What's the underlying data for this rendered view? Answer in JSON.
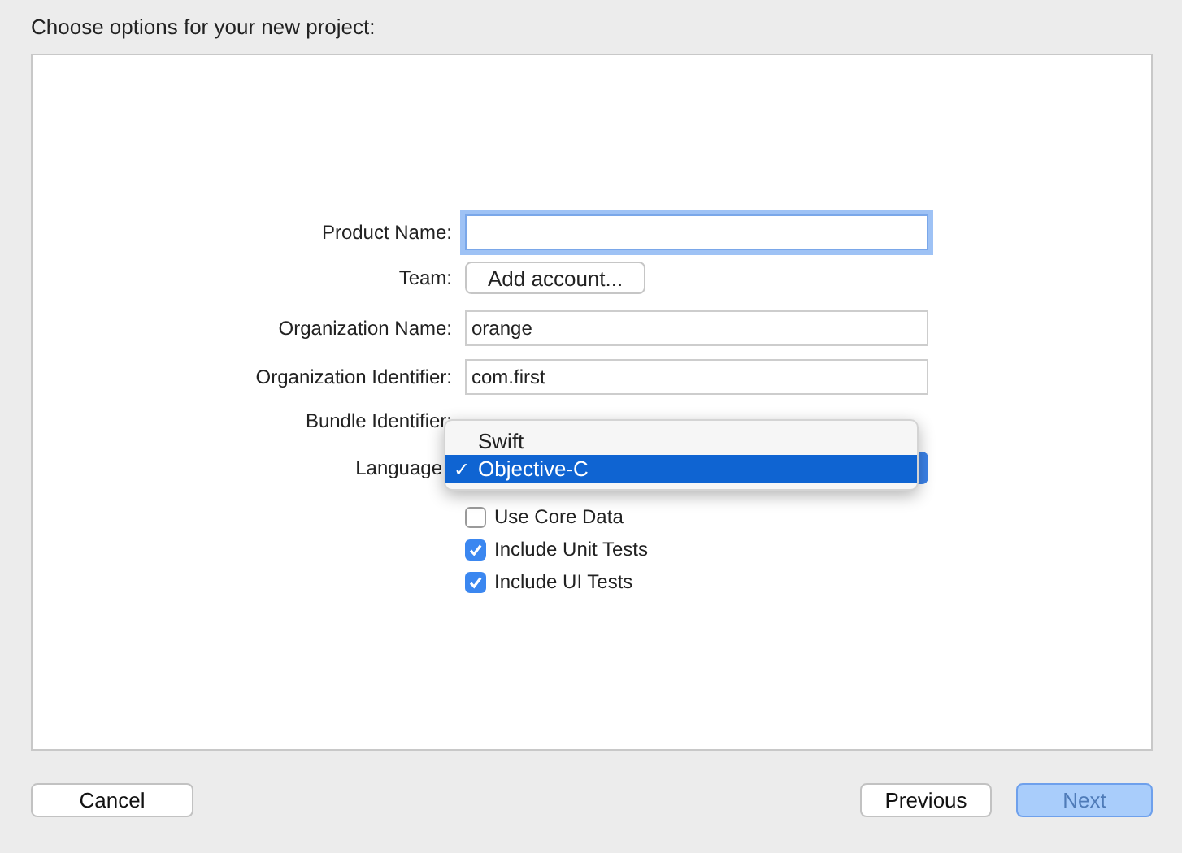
{
  "title": "Choose options for your new project:",
  "fields": [
    {
      "kind": "text",
      "label": "Product Name:",
      "focused": true
    },
    {
      "kind": "button",
      "label": "Team:",
      "button": "Add account..."
    },
    {
      "kind": "text",
      "label": "Organization Name:",
      "value": "orange",
      "focused": false
    },
    {
      "kind": "text",
      "label": "Organization Identifier:",
      "value": "com.first",
      "focused": false
    },
    {
      "kind": "static",
      "label": "Bundle Identifier:"
    },
    {
      "kind": "popup",
      "label": "Language",
      "options": [
        {
          "label": "Swift",
          "selected": false
        },
        {
          "label": "Objective-C",
          "selected": true,
          "mark": "✓"
        }
      ]
    }
  ],
  "checkboxes": [
    {
      "label": "Use Core Data",
      "checked": false
    },
    {
      "label": "Include Unit Tests",
      "checked": true
    },
    {
      "label": "Include UI Tests",
      "checked": true
    }
  ],
  "buttons": [
    {
      "label": "Cancel",
      "kind": "normal",
      "disabled": false
    },
    {
      "label": "Previous",
      "kind": "normal",
      "disabled": false
    },
    {
      "label": "Next",
      "kind": "default",
      "disabled": true
    }
  ]
}
